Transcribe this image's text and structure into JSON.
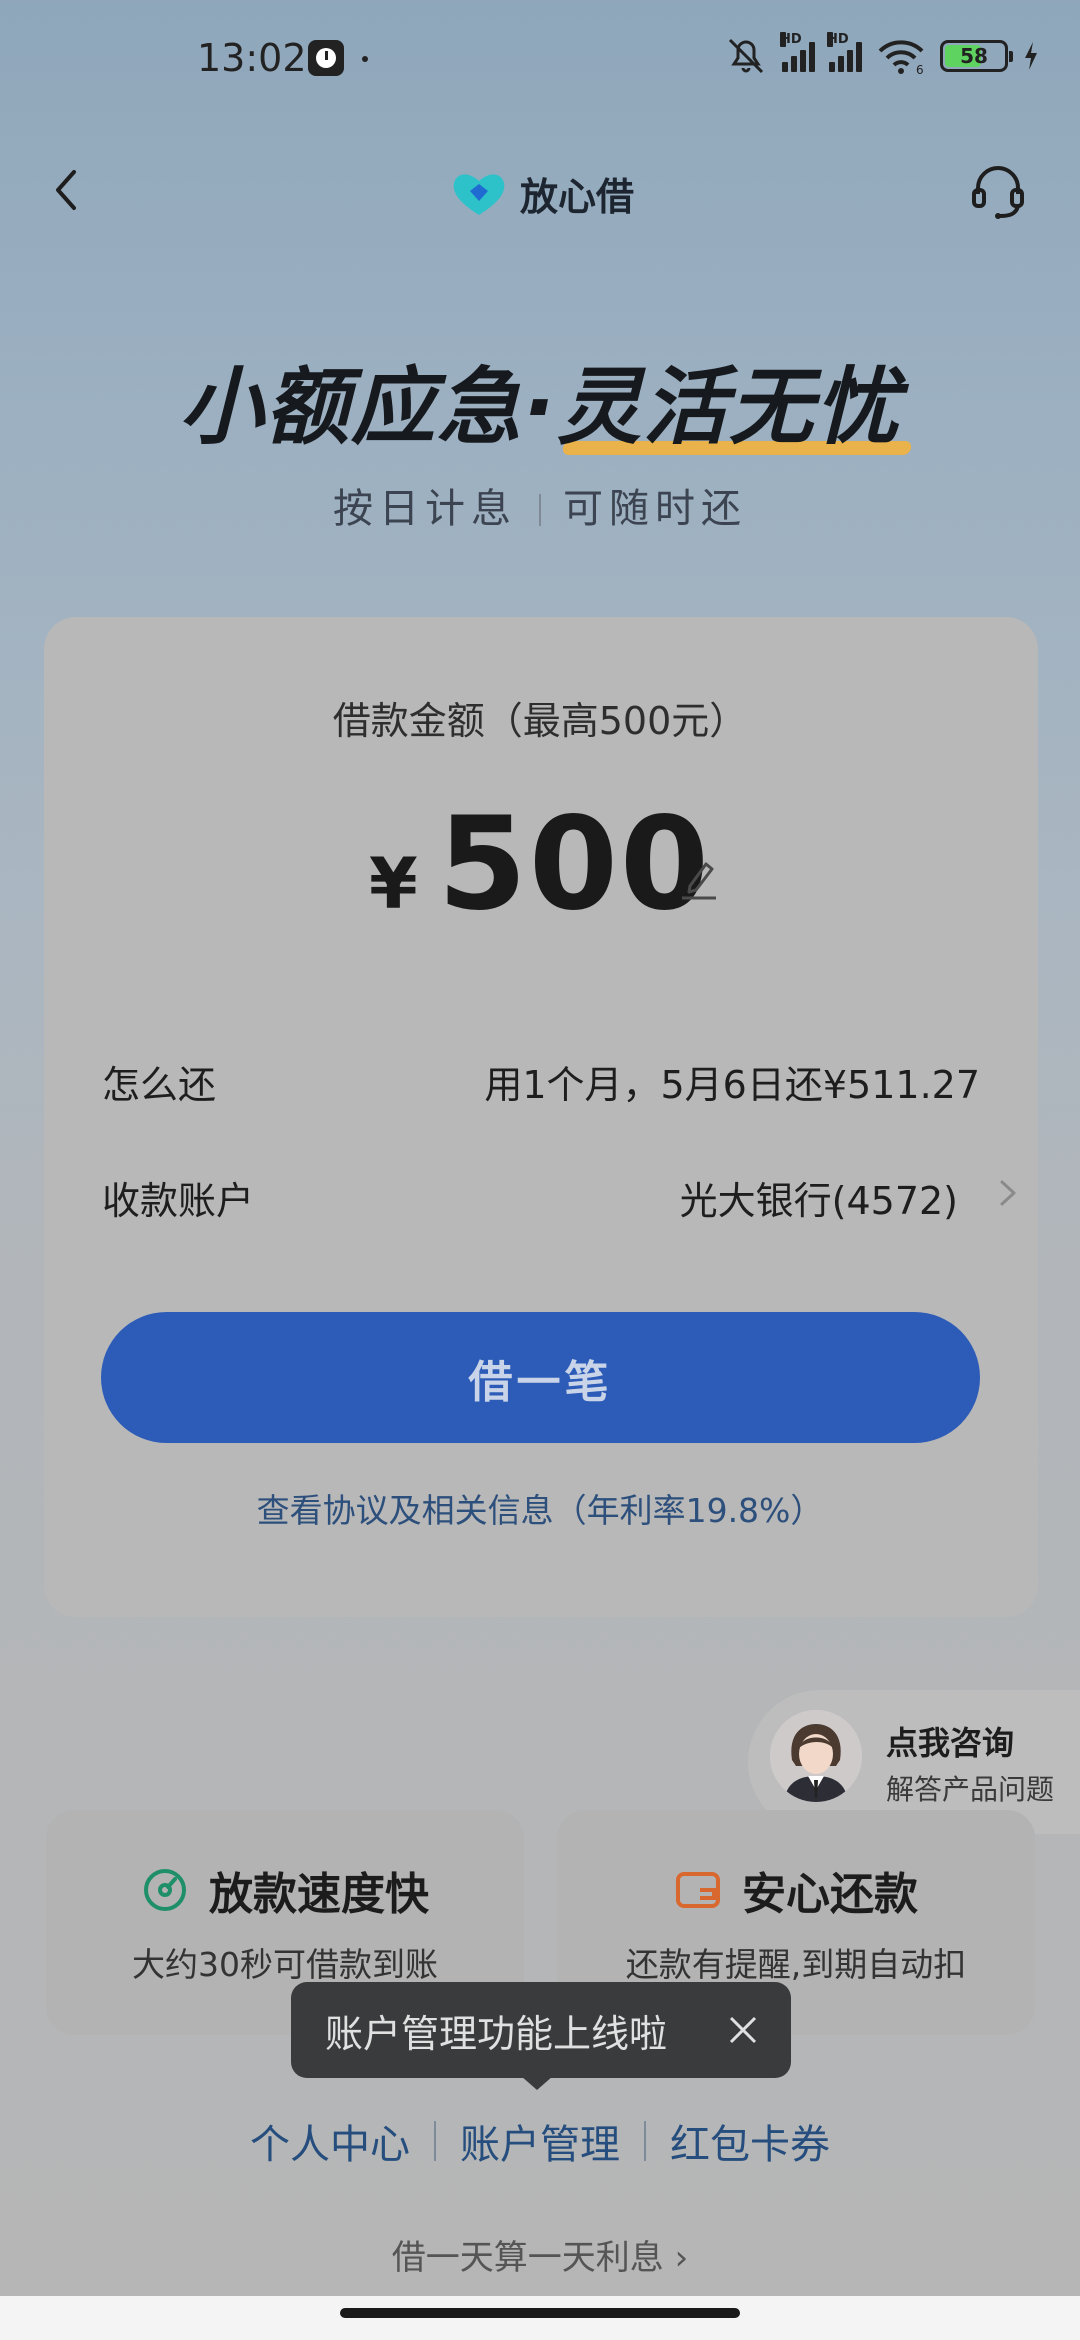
{
  "status_bar": {
    "time": "13:02",
    "battery": "58",
    "icons": [
      "app-timer-icon",
      "mute-icon",
      "signal-hd-icon",
      "signal-hd-icon",
      "wifi-6-icon",
      "battery-icon",
      "charging-icon"
    ],
    "hd_label": "HD"
  },
  "header": {
    "brand_name": "放心借",
    "brand_color": "#2dc2c9"
  },
  "hero": {
    "title_part1": "小额应急·",
    "title_part2": "灵活无忧",
    "sub_left": "按日计息",
    "sub_right": "可随时还"
  },
  "loan": {
    "amount_label": "借款金额（最高500元）",
    "currency": "¥",
    "amount": "500",
    "repay_label": "怎么还",
    "repay_value": "用1个月，5月6日还¥511.27",
    "account_label": "收款账户",
    "account_value": "光大银行(4572)",
    "borrow_button": "借一笔",
    "agreement_link": "查看协议及相关信息（年利率19.8%）",
    "accent_color": "#2c5bb8"
  },
  "consult": {
    "title": "点我咨询",
    "subtitle": "解答产品问题"
  },
  "features": [
    {
      "title": "放款速度快",
      "desc": "大约30秒可借款到账",
      "icon": "speed-gauge-icon",
      "icon_color": "#1f8f6a"
    },
    {
      "title": "安心还款",
      "desc": "还款有提醒,到期自动扣",
      "icon": "wallet-icon",
      "icon_color": "#d9682e"
    }
  ],
  "toast": {
    "text": "账户管理功能上线啦"
  },
  "links": [
    "个人中心",
    "账户管理",
    "红包卡券"
  ],
  "footer_note": "借一天算一天利息 ›"
}
